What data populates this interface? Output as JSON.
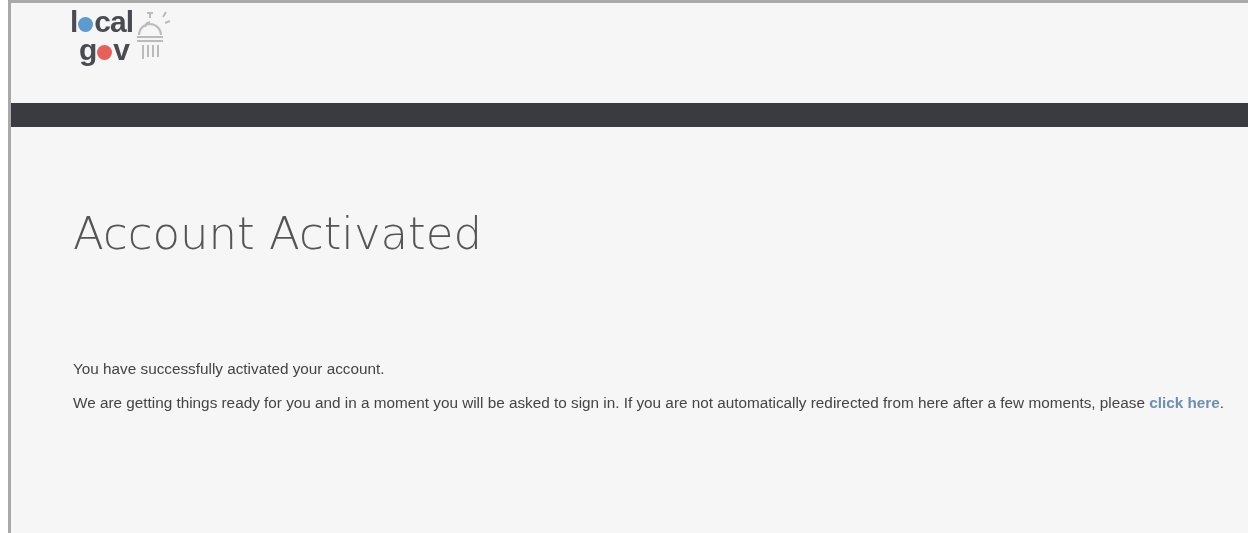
{
  "logo": {
    "top": {
      "before": "l",
      "after": "cal"
    },
    "bottom": {
      "before": "g",
      "after": "v"
    }
  },
  "heading": "Account Activated",
  "message": "You have successfully activated your account.",
  "redirect": {
    "text": "We are getting things ready for you and in a moment you will be asked to sign in. If you are not automatically redirected from here after a few moments, please ",
    "link": "click here",
    "after": "."
  }
}
